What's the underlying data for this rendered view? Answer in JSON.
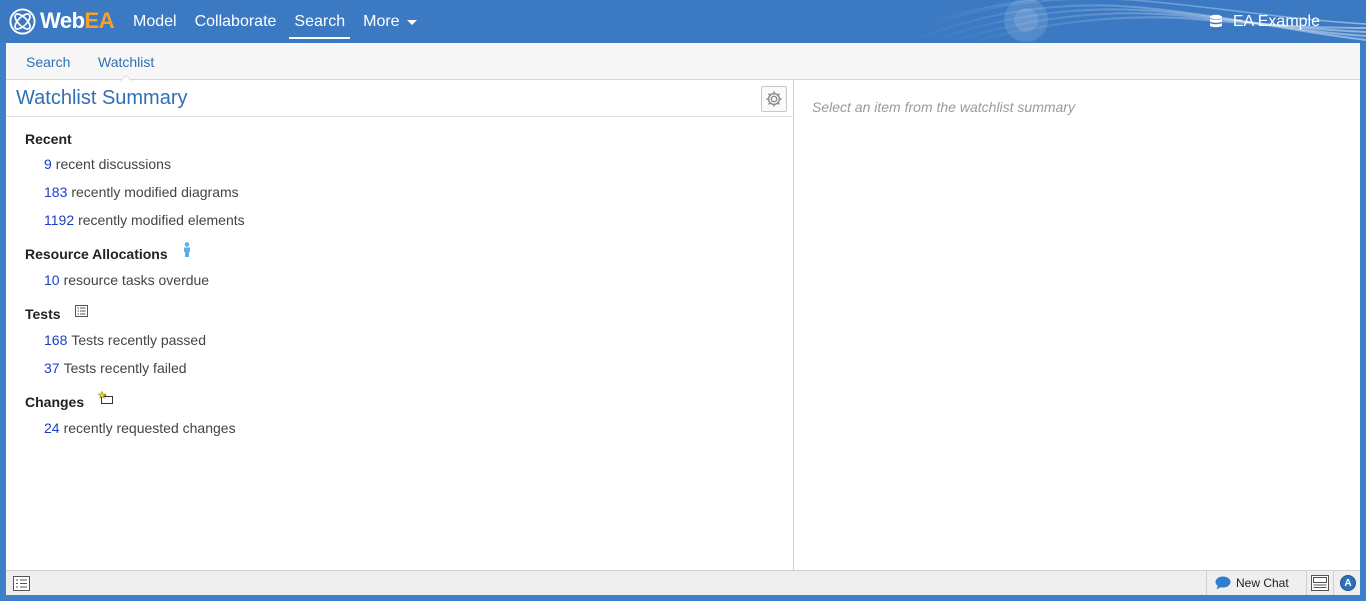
{
  "app": {
    "logo_main": "Web",
    "logo_accent": "EA",
    "repository": "EA Example"
  },
  "nav": {
    "items": [
      {
        "label": "Model"
      },
      {
        "label": "Collaborate"
      },
      {
        "label": "Search",
        "active": true
      },
      {
        "label": "More"
      }
    ]
  },
  "subtabs": [
    {
      "label": "Search"
    },
    {
      "label": "Watchlist",
      "active": true
    }
  ],
  "watchlist": {
    "title": "Watchlist Summary",
    "sections": [
      {
        "heading": "Recent",
        "icon": null,
        "rows": [
          {
            "count": "9",
            "text": "recent discussions"
          },
          {
            "count": "183",
            "text": "recently modified diagrams"
          },
          {
            "count": "1192",
            "text": "recently modified elements"
          }
        ]
      },
      {
        "heading": "Resource Allocations",
        "icon": "person-icon",
        "rows": [
          {
            "count": "10",
            "text": "resource tasks overdue"
          }
        ]
      },
      {
        "heading": "Tests",
        "icon": "test-list-icon",
        "rows": [
          {
            "count": "168",
            "text": "Tests recently passed"
          },
          {
            "count": "37",
            "text": "Tests recently failed"
          }
        ]
      },
      {
        "heading": "Changes",
        "icon": "change-folder-icon",
        "rows": [
          {
            "count": "24",
            "text": "recently requested changes"
          }
        ]
      }
    ]
  },
  "detail": {
    "hint": "Select an item from the watchlist summary"
  },
  "statusbar": {
    "chat_label": "New Chat",
    "user_initial": "A"
  },
  "colors": {
    "header_blue": "#3b7ac3",
    "link_blue": "#1a3fc4",
    "title_blue": "#2f6fb5",
    "logo_accent": "#f6a12c"
  }
}
